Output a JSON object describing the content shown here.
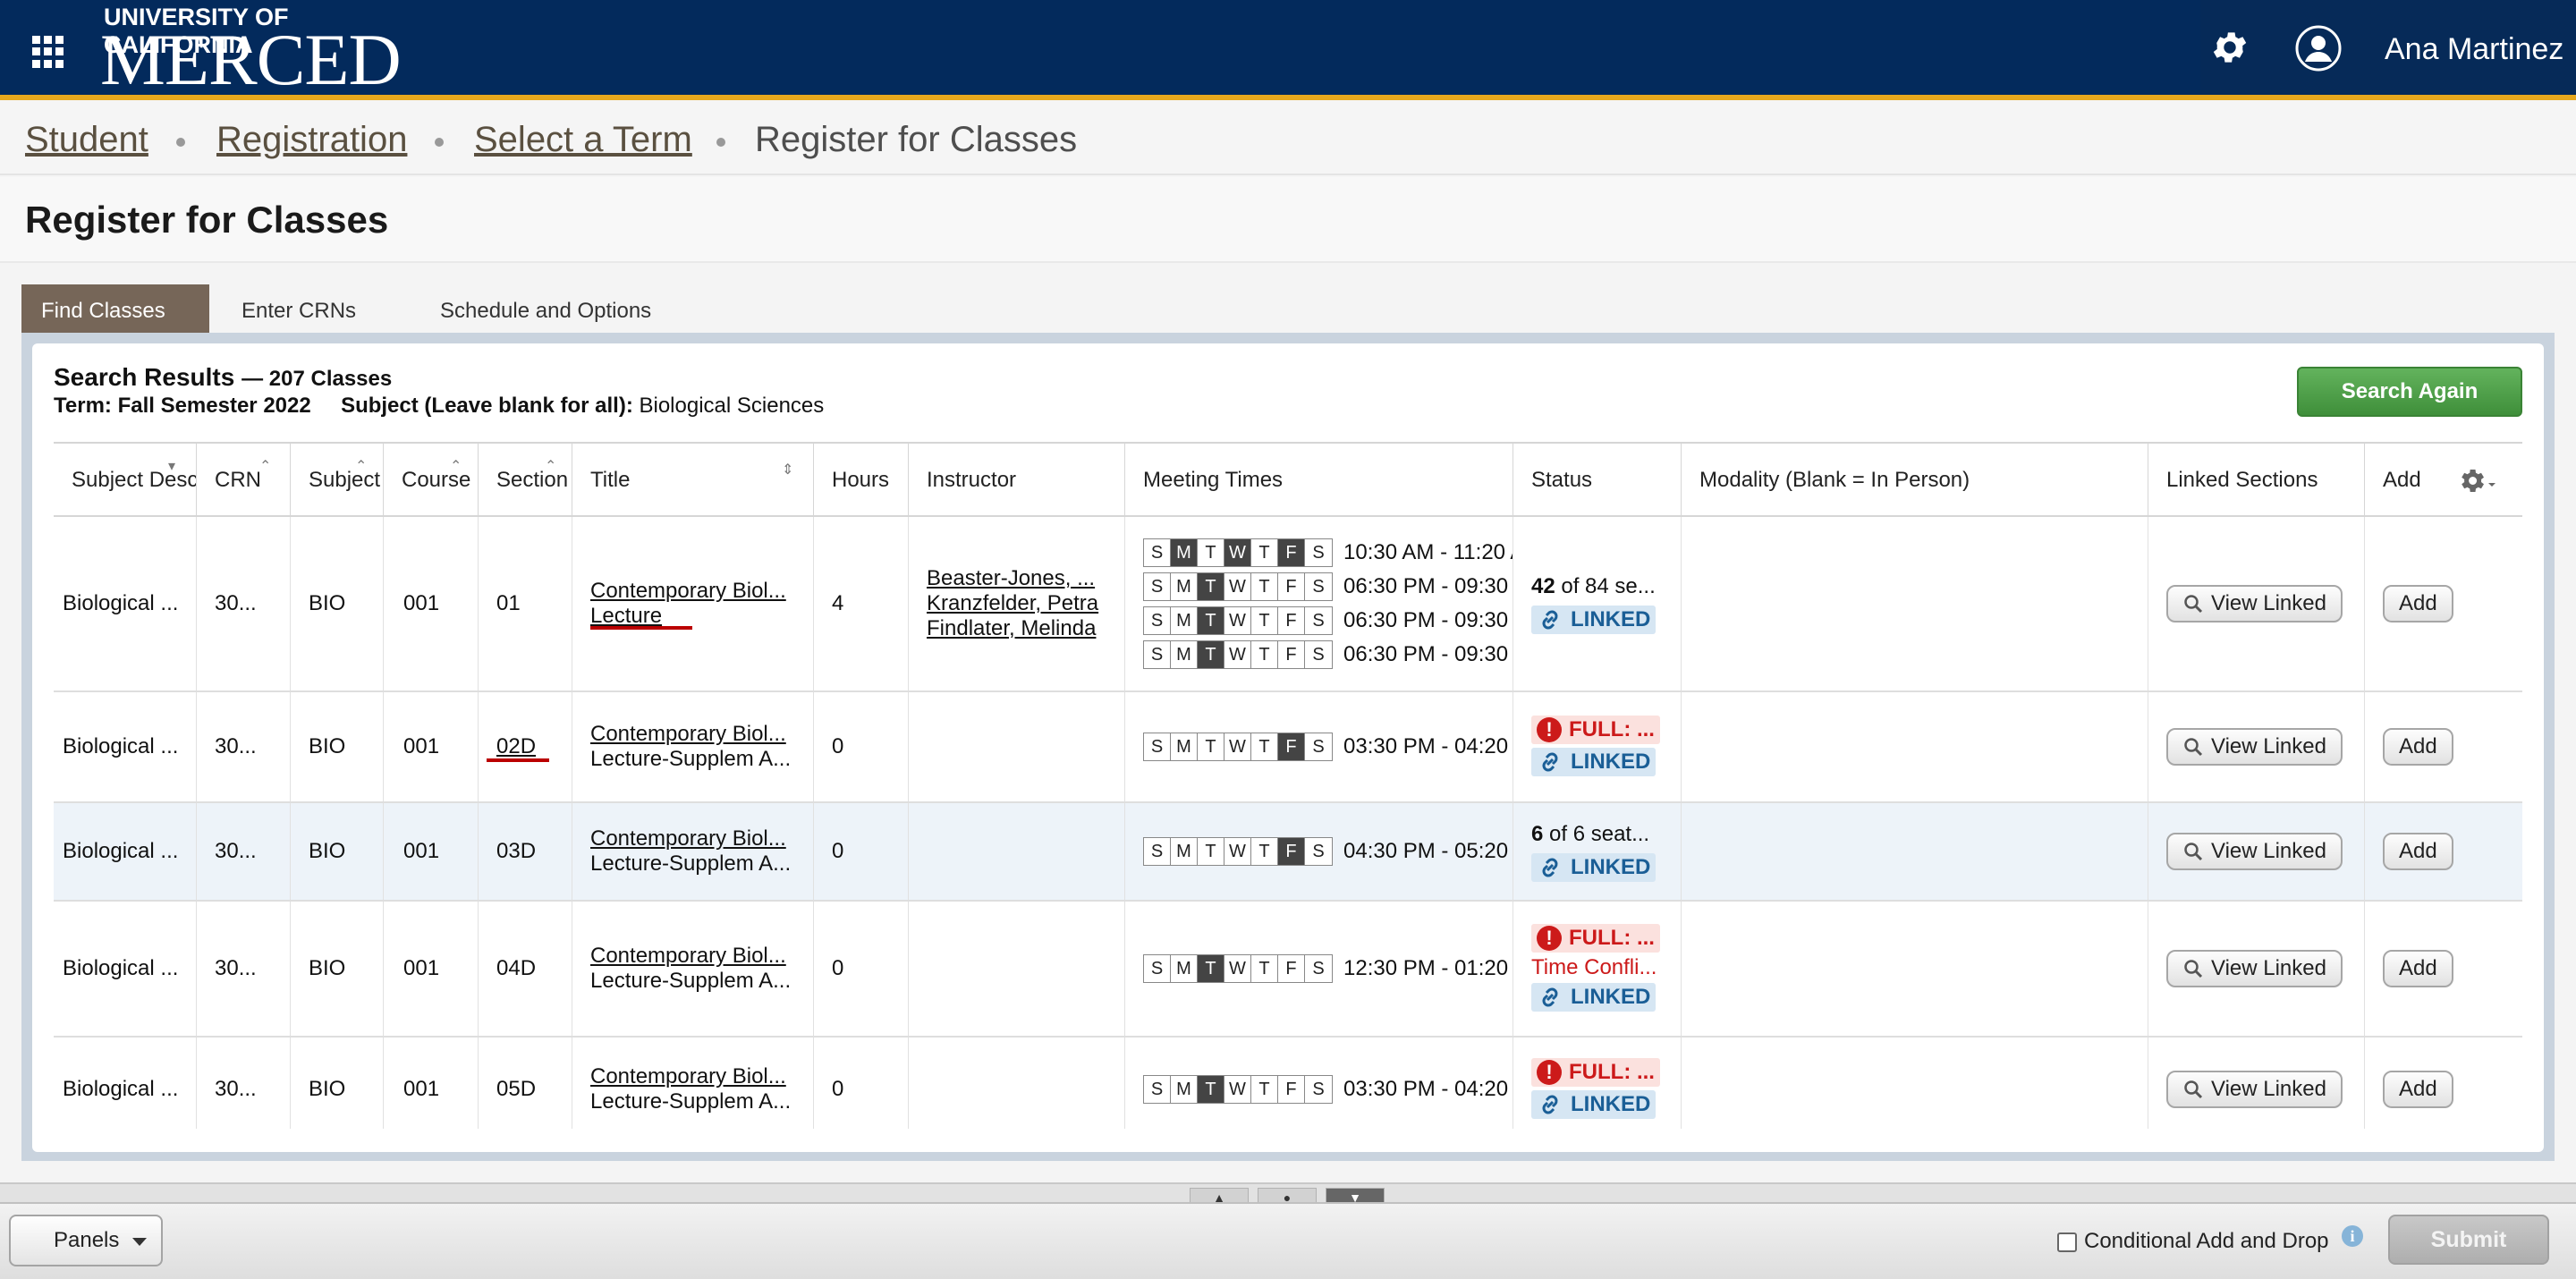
{
  "header": {
    "logo_top": "UNIVERSITY OF CALIFORNIA",
    "logo_main": "MERCED",
    "user_name": "Ana Martinez",
    "icons": [
      "apps-grid-icon",
      "gear-icon",
      "user-avatar-icon"
    ],
    "colors": {
      "navy": "#032a5c",
      "gold": "#e7a81d"
    }
  },
  "breadcrumb": [
    "Student",
    "Registration",
    "Select a Term",
    "Register for Classes"
  ],
  "page_title": "Register for Classes",
  "tabs": [
    "Find Classes",
    "Enter CRNs",
    "Schedule and Options"
  ],
  "results": {
    "title": "Search Results",
    "count": "— 207 Classes",
    "term_label": "Term: Fall Semester 2022",
    "subject_label": "Subject (Leave blank for all):",
    "subject_value": "Biological Sciences",
    "search_again": "Search Again"
  },
  "columns": [
    "Subject Desc",
    "CRN",
    "Subject",
    "Course",
    "Section",
    "Title",
    "Hours",
    "Instructor",
    "Meeting Times",
    "Status",
    "Modality (Blank = In Person)",
    "Linked Sections",
    "Add"
  ],
  "rows": [
    {
      "subject_desc": "Biological ...",
      "crn": "30...",
      "subject": "BIO",
      "course": "001",
      "section": "01",
      "title": "Contemporary Biol...",
      "title_sub": "Lecture",
      "hours": "4",
      "instructors": [
        "Beaster-Jones, ...",
        "Kranzfelder, Petra",
        "Findlater, Melinda"
      ],
      "meetings": [
        {
          "days": "MWF",
          "time": "10:30 AM - 11:20 A"
        },
        {
          "days": "T",
          "time": "06:30 PM - 09:30"
        },
        {
          "days": "T",
          "time": "06:30 PM - 09:30"
        },
        {
          "days": "T",
          "time": "06:30 PM - 09:30"
        }
      ],
      "seats_bold": "42",
      "seats_text": " of 84 se...",
      "linked": "LINKED",
      "view_linked": "View Linked",
      "add": "Add"
    },
    {
      "subject_desc": "Biological ...",
      "crn": "30...",
      "subject": "BIO",
      "course": "001",
      "section": "02D",
      "title": "Contemporary Biol...",
      "title_sub": "Lecture-Supplem A...",
      "hours": "0",
      "meetings": [
        {
          "days": "F",
          "time": "03:30 PM - 04:20"
        }
      ],
      "full": "FULL: ...",
      "linked": "LINKED",
      "view_linked": "View Linked",
      "add": "Add"
    },
    {
      "subject_desc": "Biological ...",
      "crn": "30...",
      "subject": "BIO",
      "course": "001",
      "section": "03D",
      "title": "Contemporary Biol...",
      "title_sub": "Lecture-Supplem A...",
      "hours": "0",
      "meetings": [
        {
          "days": "F",
          "time": "04:30 PM - 05:20"
        }
      ],
      "seats_bold": "6",
      "seats_text": " of 6 seat...",
      "linked": "LINKED",
      "view_linked": "View Linked",
      "add": "Add"
    },
    {
      "subject_desc": "Biological ...",
      "crn": "30...",
      "subject": "BIO",
      "course": "001",
      "section": "04D",
      "title": "Contemporary Biol...",
      "title_sub": "Lecture-Supplem A...",
      "hours": "0",
      "meetings": [
        {
          "days": "T",
          "time": "12:30 PM - 01:20"
        }
      ],
      "full": "FULL: ...",
      "conflict": "Time Confli...",
      "linked": "LINKED",
      "view_linked": "View Linked",
      "add": "Add"
    },
    {
      "subject_desc": "Biological ...",
      "crn": "30...",
      "subject": "BIO",
      "course": "001",
      "section": "05D",
      "title": "Contemporary Biol...",
      "title_sub": "Lecture-Supplem A...",
      "hours": "0",
      "meetings": [
        {
          "days": "T",
          "time": "03:30 PM - 04:20"
        }
      ],
      "full": "FULL: ...",
      "linked": "LINKED",
      "view_linked": "View Linked",
      "add": "Add"
    }
  ],
  "day_letters": [
    "S",
    "M",
    "T",
    "W",
    "T",
    "F",
    "S"
  ],
  "footer": {
    "panels": "Panels",
    "conditional": "Conditional Add and Drop",
    "info": "i",
    "submit": "Submit"
  }
}
